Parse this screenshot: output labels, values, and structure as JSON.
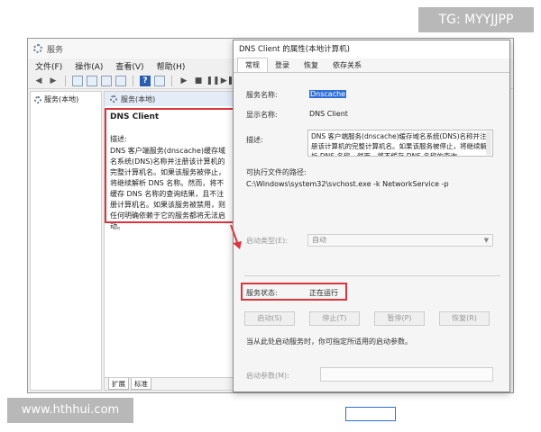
{
  "watermarks": {
    "top": "TG: MYYJJPP",
    "bottom": "www.hthhui.com"
  },
  "services_window": {
    "title": "服务",
    "menu": [
      "文件(F)",
      "操作(A)",
      "查看(V)",
      "帮助(H)"
    ],
    "tree_item": "服务(本地)",
    "main_header": "服务(本地)",
    "selected_service_name": "DNS Client",
    "description_label": "描述:",
    "description_text": "DNS 客户端服务(dnscache)缓存域名系统(DNS)名称并注册该计算机的完整计算机名。如果该服务被停止，将继续解析 DNS 名称。然而，将不缓存 DNS 名称的查询结果，且不注册计算机名。如果该服务被禁用，则任何明确依赖于它的服务都将无法启动。",
    "bottom_tabs": [
      "扩展",
      "标准"
    ]
  },
  "properties_dialog": {
    "title": "DNS Client 的属性(本地计算机)",
    "tabs": [
      "常规",
      "登录",
      "恢复",
      "依存关系"
    ],
    "service_name_label": "服务名称:",
    "service_name_value": "Dnscache",
    "display_name_label": "显示名称:",
    "display_name_value": "DNS Client",
    "description_label": "描述:",
    "description_value": "DNS 客户端服务(dnscache)缓存域名系统(DNS)名称并注册该计算机的完整计算机名。如果该服务被停止，将继续解析 DNS 名称。然而，将不缓存 DNS 名称的查询",
    "exe_path_label": "可执行文件的路径:",
    "exe_path_value": "C:\\Windows\\system32\\svchost.exe -k NetworkService -p",
    "startup_type_label": "启动类型(E):",
    "startup_type_value": "自动",
    "status_label": "服务状态:",
    "status_value": "正在运行",
    "buttons": {
      "start": "启动(S)",
      "stop": "停止(T)",
      "pause": "暂停(P)",
      "resume": "恢复(R)"
    },
    "hint": "当从此处启动服务时，你可指定所适用的启动参数。",
    "start_params_label": "启动参数(M):"
  },
  "colors": {
    "highlight_red": "#d9363e",
    "selection_blue": "#2f6fd6"
  },
  "icons": [
    "gear-icon",
    "back-arrow-icon",
    "forward-arrow-icon",
    "play-icon",
    "stop-icon",
    "pause-icon",
    "restart-icon",
    "help-icon"
  ]
}
